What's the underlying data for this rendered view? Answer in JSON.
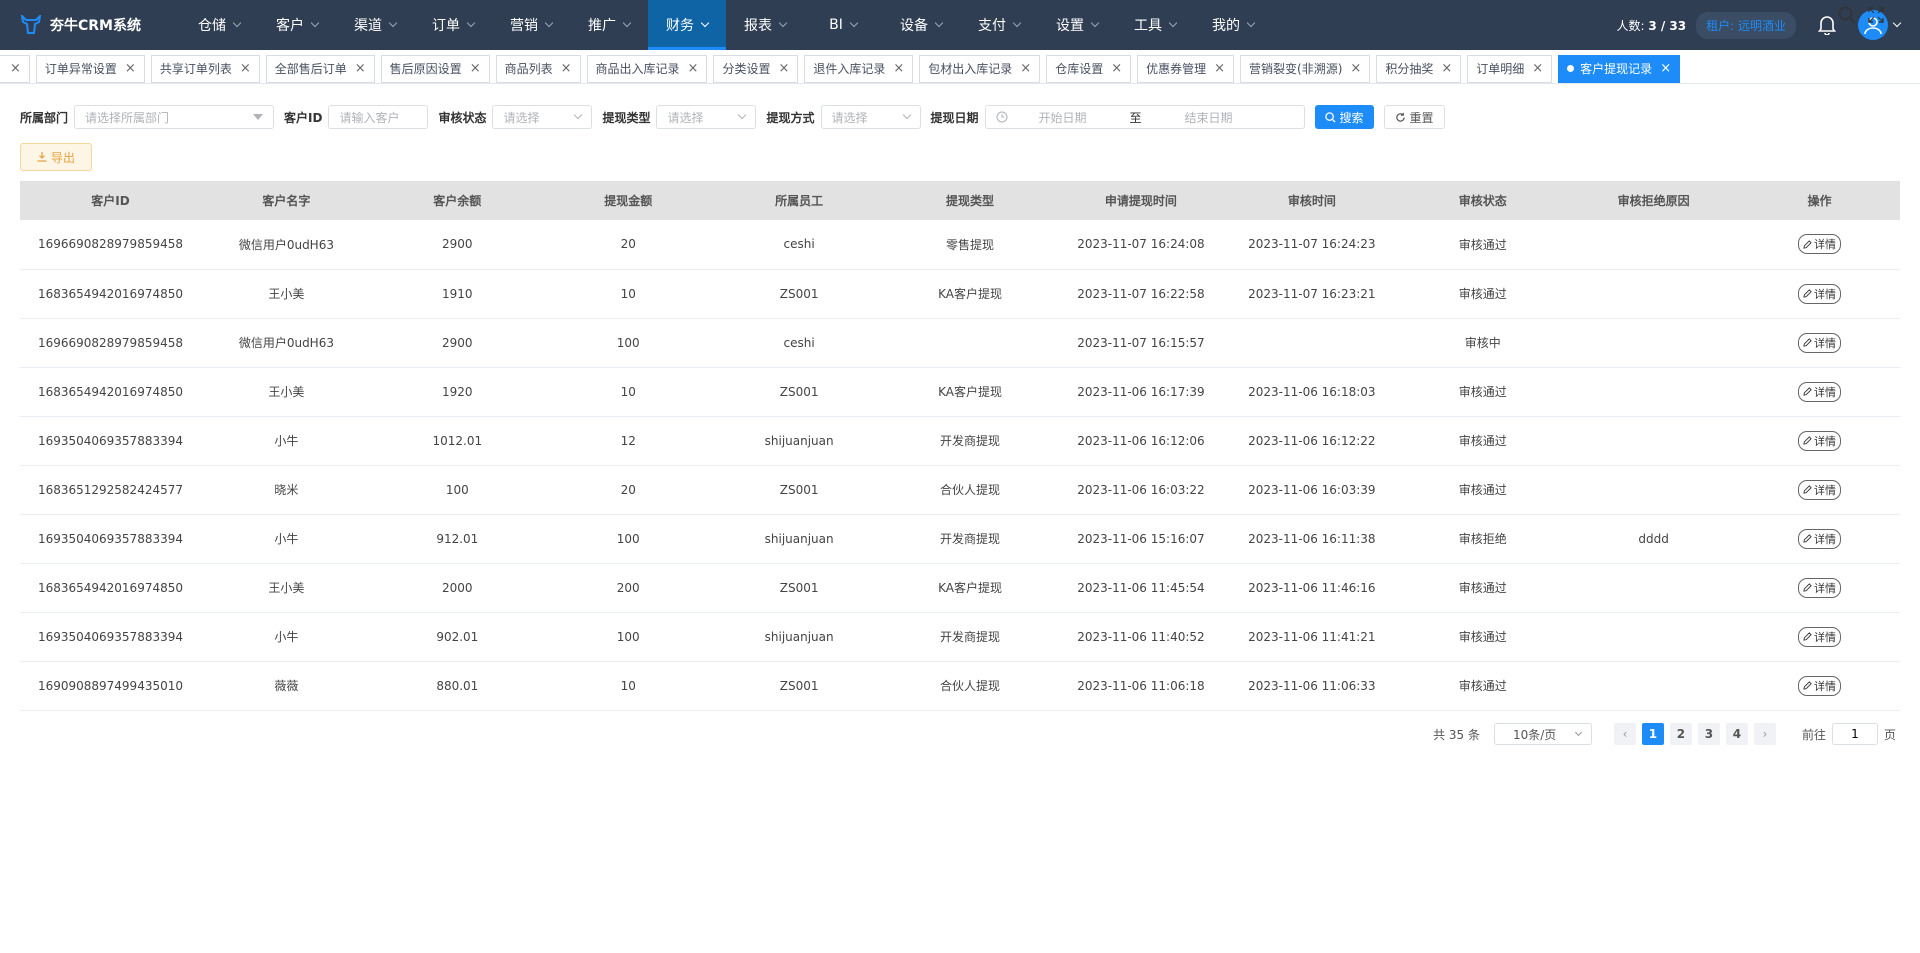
{
  "app": {
    "title": "夯牛CRM系统"
  },
  "nav": [
    {
      "label": "仓储",
      "active": false
    },
    {
      "label": "客户",
      "active": false
    },
    {
      "label": "渠道",
      "active": false
    },
    {
      "label": "订单",
      "active": false
    },
    {
      "label": "营销",
      "active": false
    },
    {
      "label": "推广",
      "active": false
    },
    {
      "label": "财务",
      "active": true
    },
    {
      "label": "报表",
      "active": false
    },
    {
      "label": "BI",
      "active": false
    },
    {
      "label": "设备",
      "active": false
    },
    {
      "label": "支付",
      "active": false
    },
    {
      "label": "设置",
      "active": false
    },
    {
      "label": "工具",
      "active": false
    },
    {
      "label": "我的",
      "active": false
    }
  ],
  "header": {
    "headcount_label": "人数: ",
    "headcount_value": "3 / 33",
    "tenant": "租户: 远明酒业"
  },
  "tabs": [
    {
      "label": "",
      "active": false
    },
    {
      "label": "订单异常设置",
      "active": false
    },
    {
      "label": "共享订单列表",
      "active": false
    },
    {
      "label": "全部售后订单",
      "active": false
    },
    {
      "label": "售后原因设置",
      "active": false
    },
    {
      "label": "商品列表",
      "active": false
    },
    {
      "label": "商品出入库记录",
      "active": false
    },
    {
      "label": "分类设置",
      "active": false
    },
    {
      "label": "退件入库记录",
      "active": false
    },
    {
      "label": "包材出入库记录",
      "active": false
    },
    {
      "label": "仓库设置",
      "active": false
    },
    {
      "label": "优惠券管理",
      "active": false
    },
    {
      "label": "营销裂变(非溯源)",
      "active": false
    },
    {
      "label": "积分抽奖",
      "active": false
    },
    {
      "label": "订单明细",
      "active": false
    },
    {
      "label": "客户提现记录",
      "active": true
    }
  ],
  "filters": {
    "dept_label": "所属部门",
    "dept_placeholder": "请选择所属部门",
    "cid_label": "客户ID",
    "cid_placeholder": "请输入客户",
    "status_label": "审核状态",
    "status_placeholder": "请选择",
    "wtype_label": "提现类型",
    "wtype_placeholder": "请选择",
    "wmethod_label": "提现方式",
    "wmethod_placeholder": "请选择",
    "date_label": "提现日期",
    "date_start": "开始日期",
    "date_sep": "至",
    "date_end": "结束日期",
    "search": "搜索",
    "reset": "重置",
    "export": "导出"
  },
  "table": {
    "columns": [
      "客户ID",
      "客户名字",
      "客户余额",
      "提现金额",
      "所属员工",
      "提现类型",
      "申请提现时间",
      "审核时间",
      "审核状态",
      "审核拒绝原因",
      "操作"
    ],
    "detail_label": "详情",
    "rows": [
      [
        "1696690828979859458",
        "微信用户0udH63",
        "2900",
        "20",
        "ceshi",
        "零售提现",
        "2023-11-07 16:24:08",
        "2023-11-07 16:24:23",
        "审核通过",
        ""
      ],
      [
        "1683654942016974850",
        "王小美",
        "1910",
        "10",
        "ZS001",
        "KA客户提现",
        "2023-11-07 16:22:58",
        "2023-11-07 16:23:21",
        "审核通过",
        ""
      ],
      [
        "1696690828979859458",
        "微信用户0udH63",
        "2900",
        "100",
        "ceshi",
        "",
        "2023-11-07 16:15:57",
        "",
        "审核中",
        ""
      ],
      [
        "1683654942016974850",
        "王小美",
        "1920",
        "10",
        "ZS001",
        "KA客户提现",
        "2023-11-06 16:17:39",
        "2023-11-06 16:18:03",
        "审核通过",
        ""
      ],
      [
        "1693504069357883394",
        "小牛",
        "1012.01",
        "12",
        "shijuanjuan",
        "开发商提现",
        "2023-11-06 16:12:06",
        "2023-11-06 16:12:22",
        "审核通过",
        ""
      ],
      [
        "1683651292582424577",
        "晓米",
        "100",
        "20",
        "ZS001",
        "合伙人提现",
        "2023-11-06 16:03:22",
        "2023-11-06 16:03:39",
        "审核通过",
        ""
      ],
      [
        "1693504069357883394",
        "小牛",
        "912.01",
        "100",
        "shijuanjuan",
        "开发商提现",
        "2023-11-06 15:16:07",
        "2023-11-06 16:11:38",
        "审核拒绝",
        "dddd"
      ],
      [
        "1683654942016974850",
        "王小美",
        "2000",
        "200",
        "ZS001",
        "KA客户提现",
        "2023-11-06 11:45:54",
        "2023-11-06 11:46:16",
        "审核通过",
        ""
      ],
      [
        "1693504069357883394",
        "小牛",
        "902.01",
        "100",
        "shijuanjuan",
        "开发商提现",
        "2023-11-06 11:40:52",
        "2023-11-06 11:41:21",
        "审核通过",
        ""
      ],
      [
        "1690908897499435010",
        "薇薇",
        "880.01",
        "10",
        "ZS001",
        "合伙人提现",
        "2023-11-06 11:06:18",
        "2023-11-06 11:06:33",
        "审核通过",
        ""
      ]
    ]
  },
  "pagination": {
    "total": "共 35 条",
    "page_size": "10条/页",
    "pages": [
      "1",
      "2",
      "3",
      "4"
    ],
    "current": "1",
    "goto_label": "前往",
    "goto_value": "1",
    "page_unit": "页"
  },
  "colors": {
    "nav_bg": "#2f3e52",
    "accent": "#1d8cf8",
    "export": "#e6a23c"
  }
}
